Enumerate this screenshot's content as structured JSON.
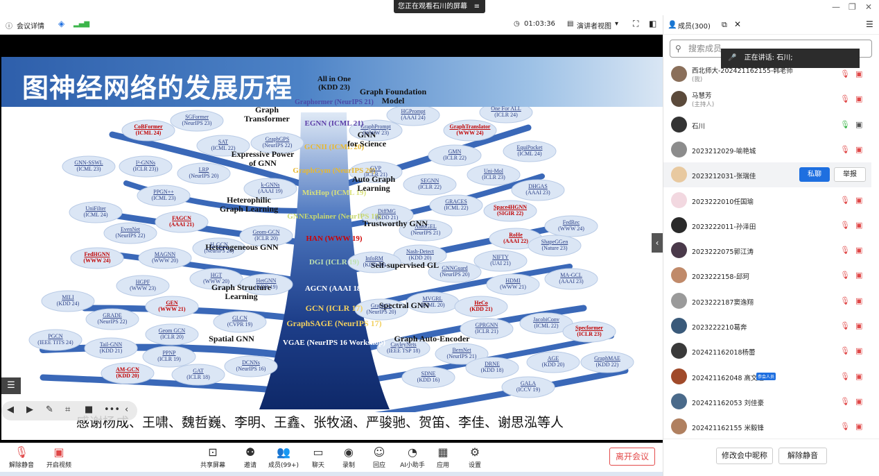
{
  "window": {
    "banner": "您正在观看石川的屏幕",
    "banner_icon": "≡"
  },
  "topbar": {
    "meeting_info": "会议详情",
    "timer": "01:03:36",
    "view_label": "演讲者视图",
    "members_label": "成员(300)"
  },
  "slide": {
    "title": "图神经网络的发展历程",
    "thanks": "感谢杨成、王啸、魏哲巍、李明、王鑫、张牧涵、严骏驰、贺笛、李佳、谢思泓等人",
    "trunk": [
      {
        "name": "All in One",
        "venue": "(KDD 23)",
        "color": "#111"
      },
      {
        "name": "Graphormer",
        "venue": "(NeurIPS 21)",
        "color": "#4a4aa8"
      },
      {
        "name": "EGNN",
        "venue": "(ICML 21)",
        "color": "#5c3ea8"
      },
      {
        "name": "GCNII",
        "venue": "(ICML 20)",
        "color": "#e8b830"
      },
      {
        "name": "GraphGym",
        "venue": "(NeurIPS 20)",
        "color": "#e8b830"
      },
      {
        "name": "MixHop",
        "venue": "(ICML 19)",
        "color": "#d8e07a"
      },
      {
        "name": "GNNExplainer",
        "venue": "(NeurIPS 19)",
        "color": "#c8d870"
      },
      {
        "name": "HAN",
        "venue": "(WWW 19)",
        "color": "#d00000"
      },
      {
        "name": "DGI",
        "venue": "(ICLR 19)",
        "color": "#bde0b0"
      },
      {
        "name": "AGCN",
        "venue": "(AAAI 18)",
        "color": "#fff"
      },
      {
        "name": "GCN",
        "venue": "(ICLR 17)",
        "color": "#f2d060"
      },
      {
        "name": "GraphSAGE",
        "venue": "(NeurIPS 17)",
        "color": "#f2d060"
      },
      {
        "name": "VGAE",
        "venue": "(NeurIPS 16 Workshop)",
        "color": "#fff"
      }
    ],
    "branches": [
      {
        "text": "Graph\nTransformer"
      },
      {
        "text": "Expressive Power\nof GNN"
      },
      {
        "text": "Heterophilic\nGraph Learning"
      },
      {
        "text": "Heterogeneous GNN"
      },
      {
        "text": "Graph Structure\nLearning"
      },
      {
        "text": "Spatial GNN"
      },
      {
        "text": "Graph Foundation\nModel"
      },
      {
        "text": "GNN\nfor Science"
      },
      {
        "text": "Auto Graph\nLearning"
      },
      {
        "text": "Trustworthy GNN"
      },
      {
        "text": "Self-supervised GL"
      },
      {
        "text": "Spectral GNN"
      },
      {
        "text": "Graph Auto-Encoder"
      }
    ],
    "leaves": [
      {
        "n": "CoBFormer",
        "v": "(ICML 24)",
        "red": true
      },
      {
        "n": "SGFormer",
        "v": "(NeurIPS 23)"
      },
      {
        "n": "SAT",
        "v": "(ICML 22)"
      },
      {
        "n": "GraphGPS",
        "v": "(NeurIPS 22)"
      },
      {
        "n": "GNN-SSWL",
        "v": "(ICML 23)"
      },
      {
        "n": "I²-GNNs",
        "v": "(ICLR 23))"
      },
      {
        "n": "LRP",
        "v": "(NeurIPS 20)"
      },
      {
        "n": "PPGN++",
        "v": "(ICML 23)"
      },
      {
        "n": "k-GNNs",
        "v": "(AAAI 19)"
      },
      {
        "n": "UniFilter",
        "v": "(ICML 24)"
      },
      {
        "n": "FAGCN",
        "v": "(AAAI 21)",
        "red": true
      },
      {
        "n": "EvenNet",
        "v": "(NeurIPS 22)"
      },
      {
        "n": "Geom-GCN",
        "v": "(ICLR 20)"
      },
      {
        "n": "H₂GCN",
        "v": "(NeurIPS 20)"
      },
      {
        "n": "FedHGNN",
        "v": "(WWW 24)",
        "red": true
      },
      {
        "n": "MAGNN",
        "v": "(WWW 20)"
      },
      {
        "n": "HGT",
        "v": "(WWW 20)"
      },
      {
        "n": "HetGNN",
        "v": "(KDD 19)"
      },
      {
        "n": "HGPF",
        "v": "(WWW 23)"
      },
      {
        "n": "MILI",
        "v": "(KDD 24)"
      },
      {
        "n": "GEN",
        "v": "(WWW 21)",
        "red": true
      },
      {
        "n": "GRADE",
        "v": "(NeurIPS 22)"
      },
      {
        "n": "GLCN",
        "v": "(CVPR 19)"
      },
      {
        "n": "Geom GCN",
        "v": "(ICLR 20)"
      },
      {
        "n": "PGCN",
        "v": "(IEEE TITS 24)"
      },
      {
        "n": "Tail-GNN",
        "v": "(KDD 21)"
      },
      {
        "n": "PPNP",
        "v": "(ICLR 19)"
      },
      {
        "n": "AM-GCN",
        "v": "(KDD 20)",
        "red": true
      },
      {
        "n": "GAT",
        "v": "(ICLR 18)"
      },
      {
        "n": "DCNNs",
        "v": "(NeurIPS 16)"
      },
      {
        "n": "HGPrompt",
        "v": "(AAAI 24)"
      },
      {
        "n": "One For ALL",
        "v": "(ICLR 24)"
      },
      {
        "n": "GraphPrompt",
        "v": "(WWW 23)"
      },
      {
        "n": "GraphTranslator",
        "v": "(WWW 24)",
        "red": true
      },
      {
        "n": "EquiPocket",
        "v": "(ICML 24)"
      },
      {
        "n": "GMN",
        "v": "(ICLR 22)"
      },
      {
        "n": "GVP",
        "v": "(ICLR 21)"
      },
      {
        "n": "Uni-Mol",
        "v": "(ICLR 23)"
      },
      {
        "n": "SEGNN",
        "v": "(ICLR 22)"
      },
      {
        "n": "DHGAS",
        "v": "(AAAI 23)"
      },
      {
        "n": "GRACES",
        "v": "(ICML 22)"
      },
      {
        "n": "Space4HGNN",
        "v": "(SIGIR 22)",
        "red": true
      },
      {
        "n": "DiffMG",
        "v": "(KDD 21)"
      },
      {
        "n": "AutoGEL",
        "v": "(NeurIPS 21)"
      },
      {
        "n": "FedRec",
        "v": "(WWW 24)"
      },
      {
        "n": "RoHe",
        "v": "(AAAI 22)",
        "red": true
      },
      {
        "n": "ShapeGGen",
        "v": "(Nature 23)"
      },
      {
        "n": "Nash-Detect",
        "v": "(KDD 20)"
      },
      {
        "n": "InfoRM",
        "v": "(KDD 20)"
      },
      {
        "n": "NIFTY",
        "v": "(UAI 21)"
      },
      {
        "n": "GNNGuard",
        "v": "(NeurIPS 20)"
      },
      {
        "n": "HDMI",
        "v": "(WWW 21)"
      },
      {
        "n": "MA-GCL",
        "v": "(AAAI 23)"
      },
      {
        "n": "MVGRL",
        "v": "(ICML 20)"
      },
      {
        "n": "GraphCL",
        "v": "(NeurIPS 20)"
      },
      {
        "n": "HeCo",
        "v": "(KDD 21)",
        "red": true
      },
      {
        "n": "JacobiConv",
        "v": "(ICML 22)"
      },
      {
        "n": "GPRGNN",
        "v": "(ICLR 21)"
      },
      {
        "n": "Specformer",
        "v": "(ICLR 23)",
        "red": true
      },
      {
        "n": "CayleyNets",
        "v": "(IEEE TSP 18)"
      },
      {
        "n": "BernNet",
        "v": "(NeurIPS 21)"
      },
      {
        "n": "AGE",
        "v": "(KDD 20)"
      },
      {
        "n": "GraphMAE",
        "v": "(KDD 22)"
      },
      {
        "n": "DRNE",
        "v": "(KDD 18)"
      },
      {
        "n": "SDNE",
        "v": "(KDD 16)"
      },
      {
        "n": "GALA",
        "v": "(ICCV 19)"
      }
    ]
  },
  "toolbar": {
    "items": [
      {
        "label": "解除静音",
        "icon": "mic-muted-icon"
      },
      {
        "label": "开启视频",
        "icon": "camera-off-icon"
      },
      {
        "label": "共享屏幕",
        "icon": "share-screen-icon"
      },
      {
        "label": "邀请",
        "icon": "invite-icon"
      },
      {
        "label": "成员(99+)",
        "icon": "members-icon"
      },
      {
        "label": "聊天",
        "icon": "chat-icon"
      },
      {
        "label": "录制",
        "icon": "record-icon"
      },
      {
        "label": "回应",
        "icon": "reaction-icon"
      },
      {
        "label": "AI小助手",
        "icon": "ai-assistant-icon"
      },
      {
        "label": "应用",
        "icon": "apps-icon"
      },
      {
        "label": "设置",
        "icon": "settings-icon"
      }
    ],
    "leave": "离开会议"
  },
  "panel": {
    "search_placeholder": "搜索成员",
    "speaking": "正在讲话: 石川;",
    "members": [
      {
        "name": "西北师大-202421162155-韩老师",
        "sub": "(我)",
        "color": "#8a6f5a"
      },
      {
        "name": "马慧芳",
        "sub": "(主持人)",
        "color": "#5b4a3b"
      },
      {
        "name": "石川",
        "sub": "",
        "color": "#333"
      },
      {
        "name": "2023212029-喻艳城",
        "sub": "",
        "color": "#8c8c8c"
      },
      {
        "name": "2023212031-张瑞佳",
        "sub": "",
        "color": "#e8c9a0",
        "hover": true
      },
      {
        "name": "2023222010任国瑜",
        "sub": "",
        "color": "#f2d8e0"
      },
      {
        "name": "2023222011-孙泽田",
        "sub": "",
        "color": "#2a2a2a"
      },
      {
        "name": "2023222075郭江涛",
        "sub": "",
        "color": "#4a3a4a"
      },
      {
        "name": "2023222158-邱珂",
        "sub": "",
        "color": "#c08a6a"
      },
      {
        "name": "2023222187窦逸翔",
        "sub": "",
        "color": "#9a9a9a"
      },
      {
        "name": "2023222210葛奔",
        "sub": "",
        "color": "#3a5a7a"
      },
      {
        "name": "202421162018杨蕾",
        "sub": "",
        "color": "#3a3a3a"
      },
      {
        "name": "202421162048 高文超",
        "sub": "",
        "color": "#a04a2a",
        "badge": "参会人员"
      },
      {
        "name": "202421162053 刘佳豪",
        "sub": "",
        "color": "#4a6a8a"
      },
      {
        "name": "202421162155 米毅锋",
        "sub": "",
        "color": "#b08060"
      }
    ],
    "private_chat": "私聊",
    "report": "举报",
    "rename": "修改会中昵称",
    "unmute": "解除静音"
  }
}
